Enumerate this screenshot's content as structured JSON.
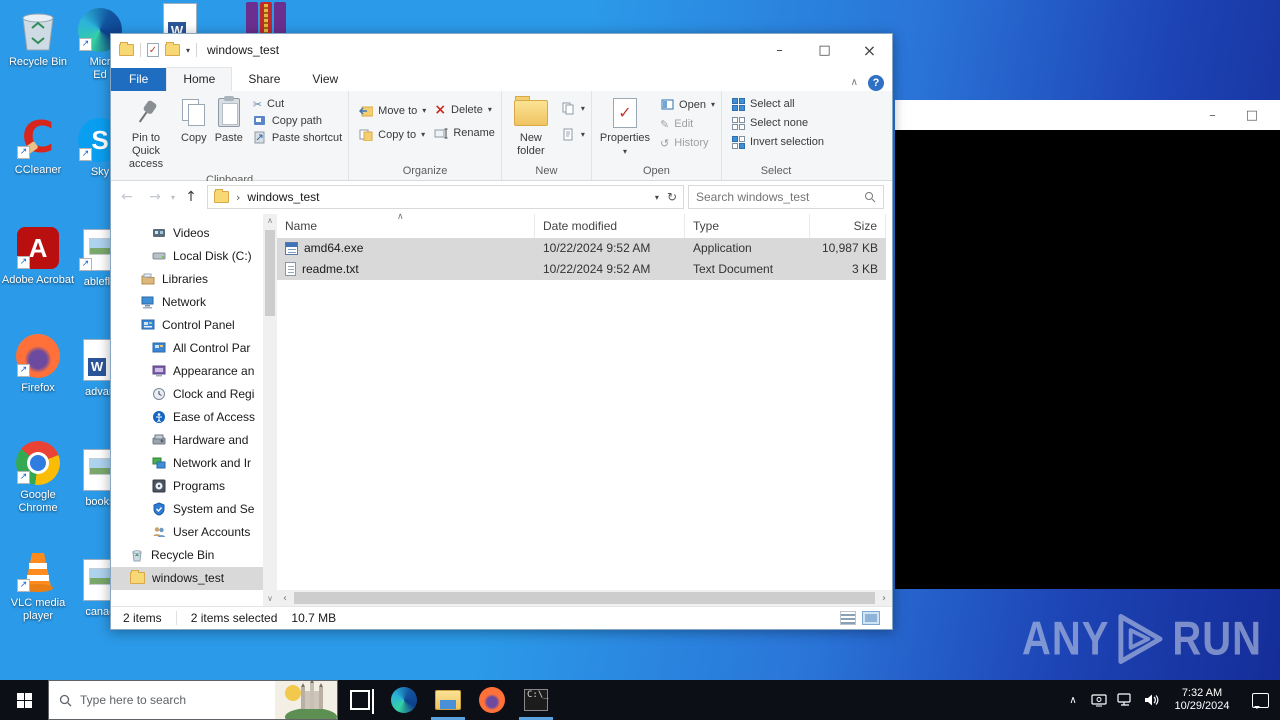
{
  "colors": {
    "accent": "#1f6dc1",
    "desktop_blue": "#2b9ae8",
    "selection_gray": "#d9d9d9",
    "taskbar_dark": "#0d0f17",
    "watermark": "#c8d2e6"
  },
  "icons": {
    "minimize": "–",
    "maximize": "□",
    "close": "×",
    "help": "?",
    "ribbon_collapse": "∧",
    "back": "←",
    "forward": "→",
    "up": "↑",
    "refresh": "↻",
    "dropdown": "▾",
    "breadcrumb_sep": "›",
    "cut": "✂",
    "delete": "×",
    "edit": "✎",
    "history": "↺",
    "scroll_up": "∧",
    "scroll_down": "∨",
    "scroll_left": "‹",
    "scroll_right": "›",
    "sort_asc": "∧",
    "check": "✓",
    "shortcut_arrow": "↗",
    "tray_chevron": "∧"
  },
  "desktop": {
    "col1": [
      {
        "label": "Recycle Bin"
      },
      {
        "label": "CCleaner"
      },
      {
        "label": "Adobe Acrobat"
      },
      {
        "label": "Firefox"
      },
      {
        "label": "Google Chrome"
      },
      {
        "label": "VLC media player"
      }
    ],
    "col2": [
      {
        "line1": "Micr",
        "line2": "Ed"
      },
      {
        "line1": "Sky",
        "line2": ""
      },
      {
        "line1": "ablefla",
        "line2": ""
      },
      {
        "line1": "advan",
        "line2": ""
      },
      {
        "line1": "books",
        "line2": ""
      },
      {
        "line1": "canac",
        "line2": ""
      }
    ],
    "top_icons": [
      "word-document",
      "winrar-archive"
    ],
    "ccleaner_letter": "C",
    "acrobat_letter": "A",
    "skype_letter": "S",
    "word_letter": "W"
  },
  "explorer": {
    "title": "windows_test",
    "tabs": {
      "file": "File",
      "home": "Home",
      "share": "Share",
      "view": "View"
    },
    "ribbon": {
      "clipboard": {
        "label": "Clipboard",
        "pin": "Pin to Quick access",
        "copy": "Copy",
        "paste": "Paste",
        "cut": "Cut",
        "copy_path": "Copy path",
        "paste_shortcut": "Paste shortcut"
      },
      "organize": {
        "label": "Organize",
        "move_to": "Move to",
        "copy_to": "Copy to",
        "delete": "Delete",
        "rename": "Rename"
      },
      "new": {
        "label": "New",
        "new_folder": "New folder"
      },
      "open": {
        "label": "Open",
        "properties": "Properties",
        "open": "Open",
        "edit": "Edit",
        "history": "History"
      },
      "select": {
        "label": "Select",
        "select_all": "Select all",
        "select_none": "Select none",
        "invert": "Invert selection"
      }
    },
    "address": {
      "path": "windows_test",
      "search_placeholder": "Search windows_test"
    },
    "nav": [
      {
        "label": "Videos"
      },
      {
        "label": "Local Disk (C:)"
      },
      {
        "label": "Libraries"
      },
      {
        "label": "Network"
      },
      {
        "label": "Control Panel"
      },
      {
        "label": "All Control Par"
      },
      {
        "label": "Appearance an"
      },
      {
        "label": "Clock and Regi"
      },
      {
        "label": "Ease of Access"
      },
      {
        "label": "Hardware and"
      },
      {
        "label": "Network and Ir"
      },
      {
        "label": "Programs"
      },
      {
        "label": "System and Se"
      },
      {
        "label": "User Accounts"
      },
      {
        "label": "Recycle Bin"
      },
      {
        "label": "windows_test"
      }
    ],
    "files": {
      "headers": {
        "name": "Name",
        "modified": "Date modified",
        "type": "Type",
        "size": "Size"
      },
      "rows": [
        {
          "name": "amd64.exe",
          "modified": "10/22/2024 9:52 AM",
          "type": "Application",
          "size": "10,987 KB"
        },
        {
          "name": "readme.txt",
          "modified": "10/22/2024 9:52 AM",
          "type": "Text Document",
          "size": "3 KB"
        }
      ]
    },
    "status": {
      "items": "2 items",
      "selected": "2 items selected",
      "size": "10.7 MB"
    }
  },
  "watermark": {
    "any": "ANY",
    "run": "RUN"
  },
  "taskbar": {
    "search_placeholder": "Type here to search",
    "time": "7:32 AM",
    "date": "10/29/2024"
  }
}
